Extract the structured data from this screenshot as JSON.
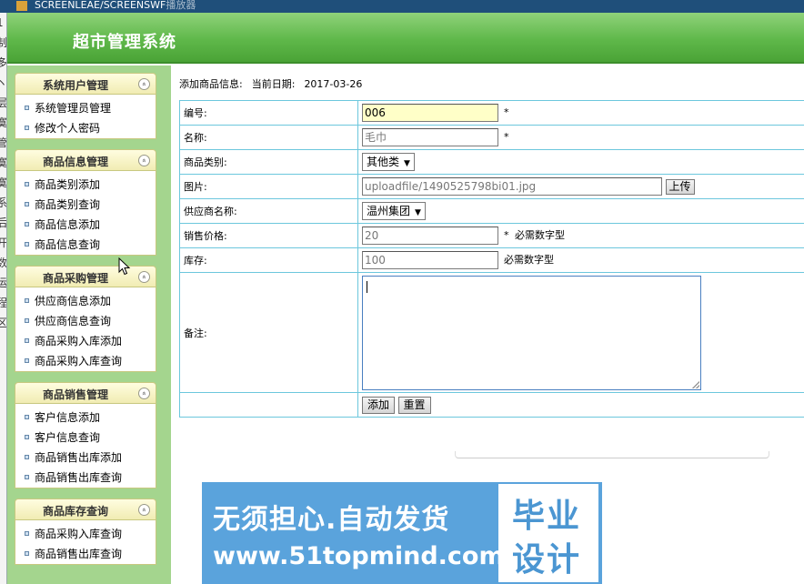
{
  "window": {
    "title": "SCREENLEAE/SCREENSWF",
    "title_suffix": "播放器"
  },
  "left_edge_glyphs": [
    "1",
    "制",
    "多",
    "ヽ",
    "层",
    "寞",
    "管",
    "寞",
    "寞",
    "系",
    "后",
    "开",
    "数",
    "运",
    "程",
    "区"
  ],
  "header": {
    "title": "超市管理系统"
  },
  "sidebar": {
    "groups": [
      {
        "title": "系统用户管理",
        "items": [
          "系统管理员管理",
          "修改个人密码"
        ]
      },
      {
        "title": "商品信息管理",
        "items": [
          "商品类别添加",
          "商品类别查询",
          "商品信息添加",
          "商品信息查询"
        ]
      },
      {
        "title": "商品采购管理",
        "items": [
          "供应商信息添加",
          "供应商信息查询",
          "商品采购入库添加",
          "商品采购入库查询"
        ]
      },
      {
        "title": "商品销售管理",
        "items": [
          "客户信息添加",
          "客户信息查询",
          "商品销售出库添加",
          "商品销售出库查询"
        ]
      },
      {
        "title": "商品库存查询",
        "items": [
          "商品采购入库查询",
          "商品销售出库查询"
        ]
      }
    ],
    "collapse_glyph": "«"
  },
  "main": {
    "info_label": "添加商品信息:",
    "date_label": "当前日期:",
    "date_value": "2017-03-26",
    "form": {
      "code": {
        "label": "编号:",
        "value": "006",
        "required": "*"
      },
      "name": {
        "label": "名称:",
        "value": "毛巾",
        "required": "*"
      },
      "category": {
        "label": "商品类别:",
        "value": "其他类"
      },
      "image": {
        "label": "图片:",
        "value": "uploadfile/1490525798bi01.jpg",
        "upload_label": "上传"
      },
      "supplier": {
        "label": "供应商名称:",
        "value": "温州集团"
      },
      "price": {
        "label": "销售价格:",
        "value": "20",
        "required": "*",
        "hint": "必需数字型"
      },
      "stock": {
        "label": "库存:",
        "value": "100",
        "hint": "必需数字型"
      },
      "remark": {
        "label": "备注:",
        "value": ""
      },
      "add_label": "添加",
      "reset_label": "重置"
    }
  },
  "watermark": {
    "line1": "无须担心.自动发货",
    "line2": "www.51topmind.com",
    "box_line1": "毕业",
    "box_line2": "设计"
  },
  "icons": {
    "caret": "caret-down-icon",
    "bullet": "square-bullet-icon",
    "collapse": "collapse-up-icon"
  },
  "colors": {
    "header_green": "#5fb84a",
    "sidebar_green": "#a4d58e",
    "table_border": "#6cc7dd",
    "banner_blue": "#5aa3dc"
  }
}
